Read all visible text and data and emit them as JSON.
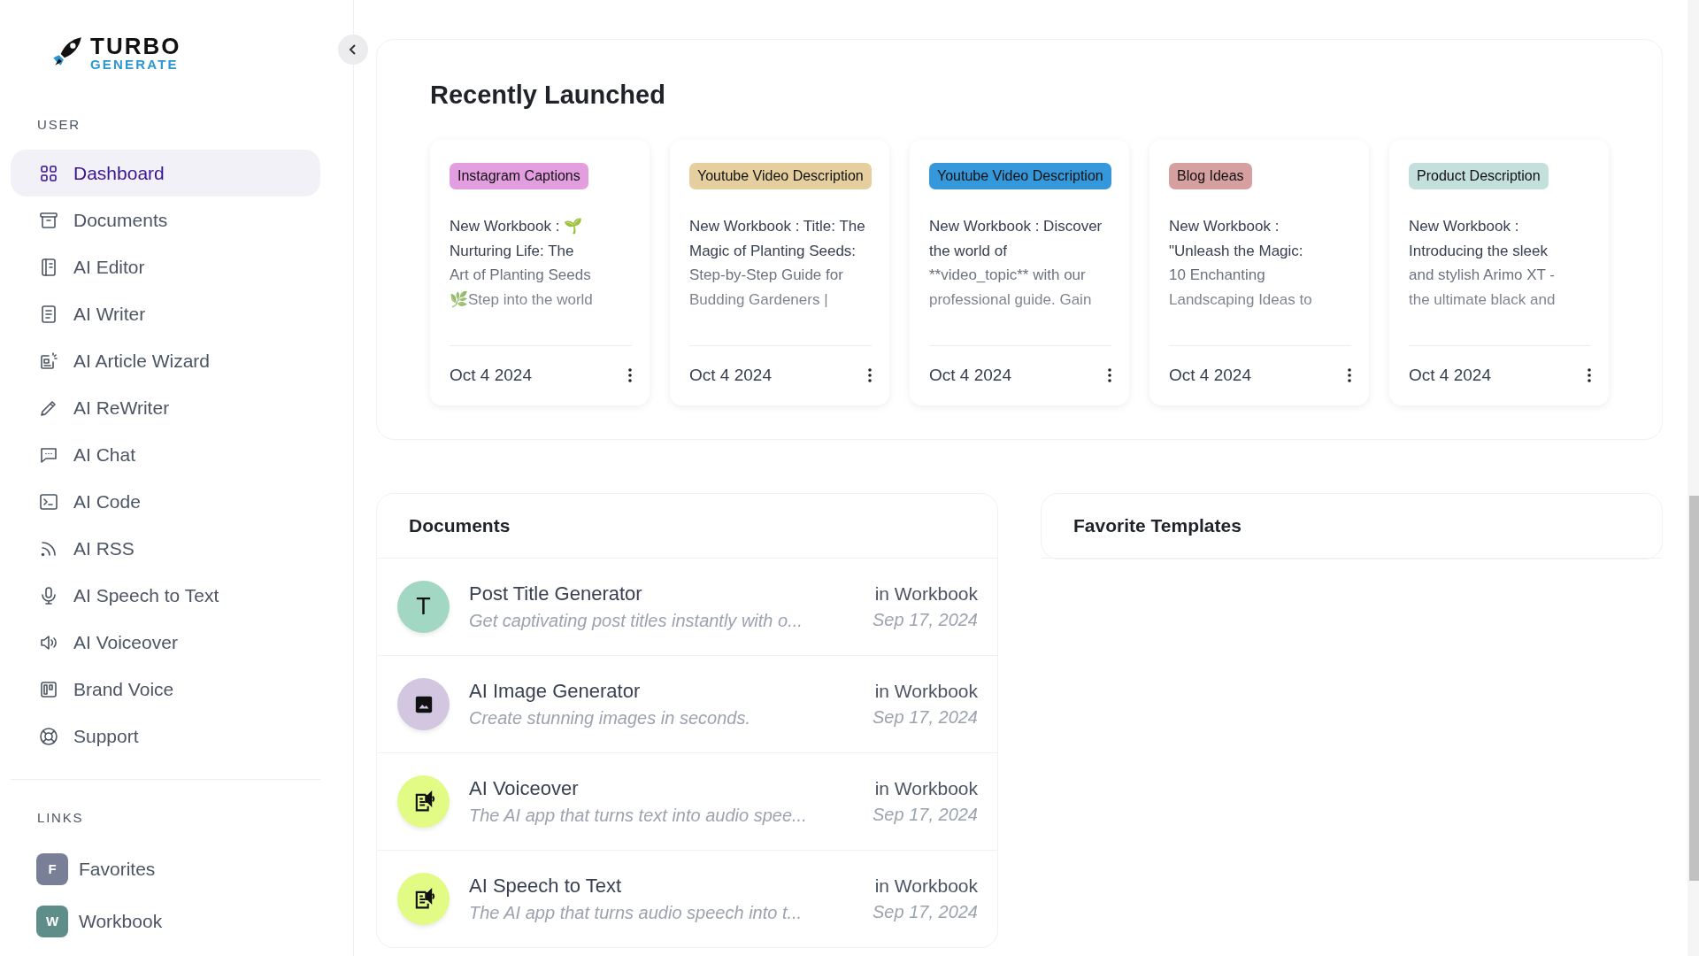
{
  "sidebar": {
    "logo": {
      "top": "TURBO",
      "bottom": "GENERATE"
    },
    "sections": [
      {
        "label": "USER",
        "items": [
          {
            "label": "Dashboard",
            "selected": true
          },
          {
            "label": "Documents",
            "selected": false
          },
          {
            "label": "AI Editor",
            "selected": false
          },
          {
            "label": "AI Writer",
            "selected": false
          },
          {
            "label": "AI Article Wizard",
            "selected": false
          },
          {
            "label": "AI ReWriter",
            "selected": false
          },
          {
            "label": "AI Chat",
            "selected": false
          },
          {
            "label": "AI Code",
            "selected": false
          },
          {
            "label": "AI RSS",
            "selected": false
          },
          {
            "label": "AI Speech to Text",
            "selected": false
          },
          {
            "label": "AI Voiceover",
            "selected": false
          },
          {
            "label": "Brand Voice",
            "selected": false
          },
          {
            "label": "Support",
            "selected": false
          }
        ]
      },
      {
        "label": "LINKS",
        "links": [
          {
            "badge": "F",
            "label": "Favorites",
            "color": "#7a7f98"
          },
          {
            "badge": "W",
            "label": "Workbook",
            "color": "#5f8e8a"
          }
        ]
      }
    ]
  },
  "recently_launched": {
    "title": "Recently Launched",
    "cards": [
      {
        "tag": "Instagram Captions",
        "color": "#e39ee0",
        "lines": [
          "New Workbook : 🌱",
          "Nurturing Life: The",
          "Art of Planting Seeds",
          "🌿Step into the world"
        ],
        "date": "Oct 4 2024"
      },
      {
        "tag": "Youtube Video Description",
        "color": "#e6cf9e",
        "lines": [
          "New Workbook : Title: The",
          "Magic of Planting Seeds:",
          "Step-by-Step Guide for",
          "Budding Gardeners |"
        ],
        "date": "Oct 4 2024"
      },
      {
        "tag": "Youtube Video Description",
        "color": "#3498db",
        "lines": [
          "New Workbook : Discover",
          "the world of",
          "**video_topic** with our",
          "professional guide. Gain"
        ],
        "date": "Oct 4 2024"
      },
      {
        "tag": "Blog Ideas",
        "color": "#d6a0a0",
        "lines": [
          "New Workbook :",
          "\"Unleash the Magic:",
          "10 Enchanting",
          "Landscaping Ideas to"
        ],
        "date": "Oct 4 2024"
      },
      {
        "tag": "Product Description",
        "color": "#c3e0dc",
        "lines": [
          "New Workbook :",
          "Introducing the sleek",
          "and stylish Arimo XT -",
          "the ultimate black and"
        ],
        "date": "Oct 4 2024"
      }
    ]
  },
  "documents": {
    "title": "Documents",
    "rows": [
      {
        "avatar": {
          "kind": "letter",
          "text": "T"
        },
        "color": "#a2d7c4",
        "name": "Post Title Generator",
        "description": "Get captivating post titles instantly with o...",
        "location": "in Workbook",
        "date": "Sep 17, 2024"
      },
      {
        "avatar": {
          "kind": "image"
        },
        "color": "#d3c6e0",
        "name": "AI Image Generator",
        "description": "Create stunning images in seconds.",
        "location": "in Workbook",
        "date": "Sep 17, 2024"
      },
      {
        "avatar": {
          "kind": "audio"
        },
        "color": "#e2fb85",
        "name": "AI Voiceover",
        "description": "The AI app that turns text into audio spee...",
        "location": "in Workbook",
        "date": "Sep 17, 2024"
      },
      {
        "avatar": {
          "kind": "audio"
        },
        "color": "#e2fb85",
        "name": "AI Speech to Text",
        "description": "The AI app that turns audio speech into t...",
        "location": "in Workbook",
        "date": "Sep 17, 2024"
      }
    ]
  },
  "favorite_templates": {
    "title": "Favorite Templates"
  }
}
